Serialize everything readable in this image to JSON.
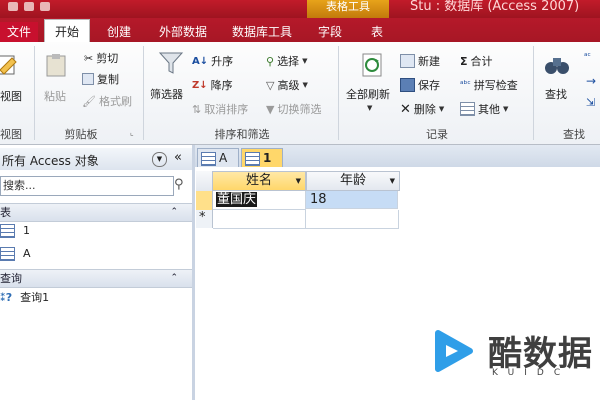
{
  "titlebar": {
    "contextual_tools": "表格工具",
    "app_title": "Stu : 数据库 (Access 2007)"
  },
  "ribbon_tabs": {
    "file": "文件",
    "home": "开始",
    "create": "创建",
    "external_data": "外部数据",
    "db_tools": "数据库工具",
    "fields": "字段",
    "table": "表"
  },
  "ribbon": {
    "views": {
      "view": "视图",
      "group": "视图"
    },
    "clipboard": {
      "paste": "粘贴",
      "cut": "剪切",
      "copy": "复制",
      "format_painter": "格式刷",
      "group": "剪贴板"
    },
    "sort_filter": {
      "filter": "筛选器",
      "ascending": "升序",
      "descending": "降序",
      "remove_sort": "取消排序",
      "selection": "选择",
      "advanced": "高级",
      "toggle_filter": "切换筛选",
      "group": "排序和筛选"
    },
    "records": {
      "refresh_all": "全部刷新",
      "new": "新建",
      "save": "保存",
      "delete": "删除",
      "totals": "合计",
      "spelling": "拼写检查",
      "more": "其他",
      "group": "记录"
    },
    "find": {
      "find": "查找",
      "group": "查找"
    }
  },
  "nav_pane": {
    "title": "所有 Access 对象",
    "search_placeholder": "搜索...",
    "sections": [
      {
        "label": "表",
        "items": [
          "1",
          "A"
        ]
      },
      {
        "label": "查询",
        "items": [
          "查询1"
        ]
      }
    ]
  },
  "doc_tabs": [
    "A",
    "1"
  ],
  "datasheet": {
    "columns": [
      "姓名",
      "年龄"
    ],
    "rows": [
      {
        "name": "董国庆",
        "age": "18"
      }
    ],
    "new_row_marker": "*"
  },
  "watermark": {
    "brand": "酷数据",
    "sub": "KUIDC"
  },
  "colors": {
    "title_red": "#b5192a",
    "context_orange": "#e7a31a",
    "selection_yellow": "#ffd76a",
    "row_highlight": "#c6dcf5"
  }
}
